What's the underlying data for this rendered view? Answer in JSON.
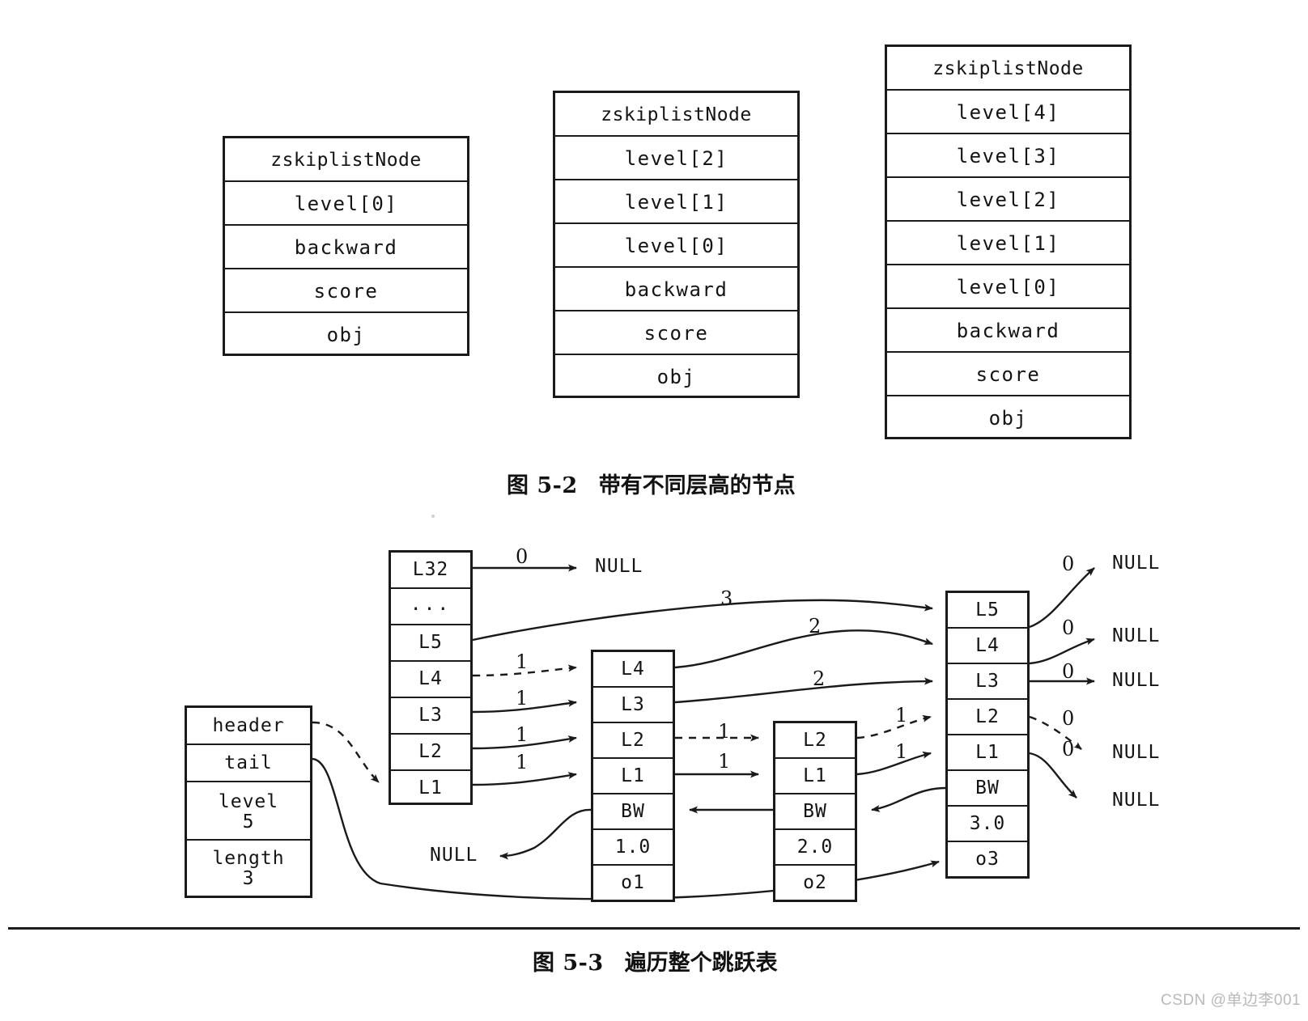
{
  "page": {
    "background": "#ffffff",
    "ink": "#141414"
  },
  "figure_5_2": {
    "caption_number": "图 5-2",
    "caption_title": "带有不同层高的节点",
    "nodes": [
      {
        "id": "node-level1",
        "header": "zskiplistNode",
        "fields": [
          "level[0]",
          "backward",
          "score",
          "obj"
        ]
      },
      {
        "id": "node-level3",
        "header": "zskiplistNode",
        "fields": [
          "level[2]",
          "level[1]",
          "level[0]",
          "backward",
          "score",
          "obj"
        ]
      },
      {
        "id": "node-level5",
        "header": "zskiplistNode",
        "fields": [
          "level[4]",
          "level[3]",
          "level[2]",
          "level[1]",
          "level[0]",
          "backward",
          "score",
          "obj"
        ]
      }
    ]
  },
  "figure_5_3": {
    "caption_number": "图 5-3",
    "caption_title": "遍历整个跳跃表",
    "zskiplist": {
      "title": "zskiplist-struct",
      "rows": [
        {
          "label": "header",
          "value": ""
        },
        {
          "label": "tail",
          "value": ""
        },
        {
          "label": "level",
          "value": "5"
        },
        {
          "label": "length",
          "value": "3"
        }
      ]
    },
    "header_node": {
      "title": "header-node",
      "cells": [
        "L32",
        "...",
        "L5",
        "L4",
        "L3",
        "L2",
        "L1"
      ]
    },
    "node1": {
      "title": "node-o1",
      "cells": [
        "L4",
        "L3",
        "L2",
        "L1",
        "BW",
        "1.0",
        "o1"
      ]
    },
    "node2": {
      "title": "node-o2",
      "cells": [
        "L2",
        "L1",
        "BW",
        "2.0",
        "o2"
      ]
    },
    "node3": {
      "title": "node-o3",
      "cells": [
        "L5",
        "L4",
        "L3",
        "L2",
        "L1",
        "BW",
        "3.0",
        "o3"
      ]
    },
    "null_labels": {
      "header_l32": "NULL",
      "backward_null": "NULL",
      "tail_1": "NULL",
      "tail_2": "NULL",
      "tail_3": "NULL",
      "tail_4": "NULL",
      "tail_5": "NULL"
    },
    "span_labels": {
      "header_l32_to_null": "0",
      "header_l5_to_n3": "3",
      "header_l4_to_n1": "1",
      "header_l3_to_n1": "1",
      "header_l2_to_n1": "1",
      "header_l1_to_n1": "1",
      "n1_l4_to_n3": "2",
      "n1_l3_to_n3": "2",
      "n1_l2_to_n2": "1",
      "n1_l1_to_n2": "1",
      "n2_l2_to_n3": "1",
      "n2_l1_to_n3": "1",
      "n3_l5_to_null": "0",
      "n3_l4_to_null": "0",
      "n3_l3_to_null": "0",
      "n3_l2_to_null": "0",
      "n3_l1_to_null": "0"
    }
  },
  "watermark": "CSDN @单边李001"
}
